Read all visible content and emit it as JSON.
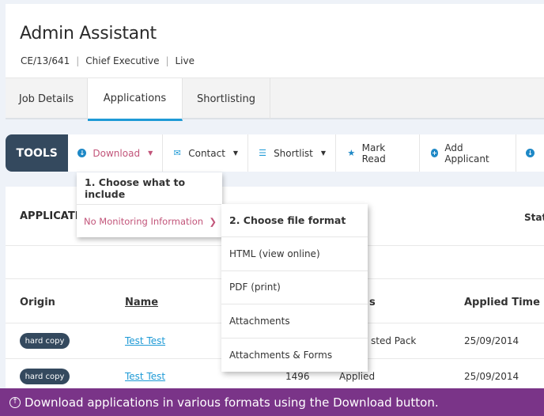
{
  "header": {
    "title": "Admin Assistant",
    "meta": [
      "CE/13/641",
      "Chief Executive",
      "Live"
    ]
  },
  "tabs": [
    {
      "label": "Job Details",
      "active": false
    },
    {
      "label": "Applications",
      "active": true
    },
    {
      "label": "Shortlisting",
      "active": false
    }
  ],
  "tools": {
    "label": "TOOLS",
    "items": [
      {
        "label": "Download",
        "icon": "download-circle-icon",
        "dropdown": true
      },
      {
        "label": "Contact",
        "icon": "envelope-icon",
        "dropdown": true
      },
      {
        "label": "Shortlist",
        "icon": "list-icon",
        "dropdown": true
      },
      {
        "label": "Mark Read",
        "icon": "star-icon",
        "dropdown": false
      },
      {
        "label": "Add Applicant",
        "icon": "plus-circle-icon",
        "dropdown": false
      }
    ]
  },
  "download_menu": {
    "step1_heading": "1. Choose what to include",
    "step1_option": "No Monitoring Information",
    "step2_heading": "2. Choose file format",
    "formats": [
      "HTML (view online)",
      "PDF (print)",
      "Attachments",
      "Attachments & Forms"
    ]
  },
  "applications": {
    "title": "APPLICATI",
    "status_label": "Statu",
    "columns": {
      "origin": "Origin",
      "name": "Name",
      "status": "s",
      "applied": "Applied Time"
    },
    "rows": [
      {
        "origin": "hard copy",
        "name": "Test Test",
        "id": "",
        "status": "sted Pack",
        "applied": "25/09/2014"
      },
      {
        "origin": "hard copy",
        "name": "Test Test",
        "id": "1496",
        "status": "Applied",
        "applied": "25/09/2014"
      }
    ]
  },
  "banner": {
    "icon": "arrow-up-circle-icon",
    "text": "Download applications in various formats using the Download button."
  },
  "colors": {
    "accent_blue": "#1e9ad6",
    "download_pink": "#c2557a",
    "tools_dark": "#34495e",
    "banner_purple": "#7a3488"
  }
}
